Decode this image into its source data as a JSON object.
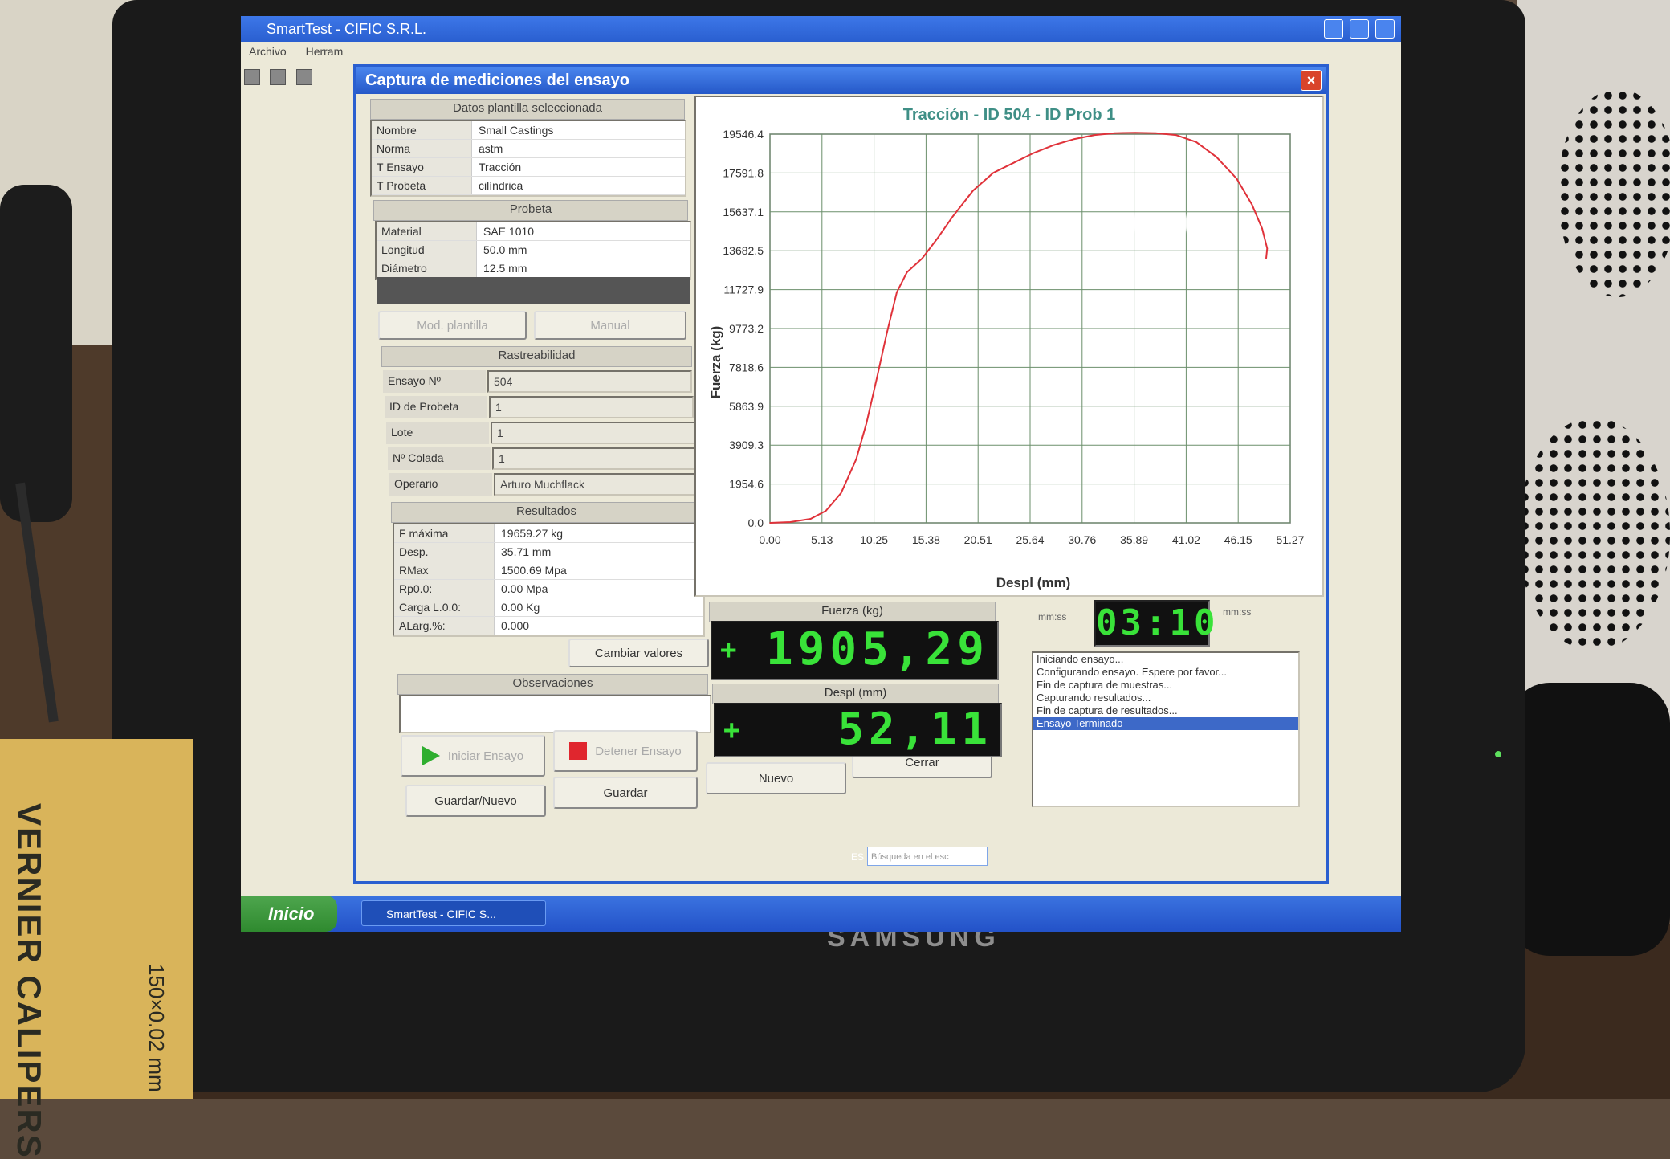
{
  "app": {
    "title": "SmartTest - CIFIC S.R.L.",
    "menu": [
      "Archivo",
      "Herram"
    ]
  },
  "dialog": {
    "title": "Captura de mediciones del ensayo",
    "close_label": "×",
    "template": {
      "header": "Datos plantilla seleccionada",
      "rows": [
        {
          "k": "Nombre",
          "v": "Small Castings"
        },
        {
          "k": "Norma",
          "v": "astm"
        },
        {
          "k": "T Ensayo",
          "v": "Tracción"
        },
        {
          "k": "T Probeta",
          "v": "cilíndrica"
        }
      ]
    },
    "probeta": {
      "header": "Probeta",
      "rows": [
        {
          "k": "Material",
          "v": "SAE 1010"
        },
        {
          "k": "Longitud",
          "v": "50.0 mm"
        },
        {
          "k": "Diámetro",
          "v": "12.5 mm"
        }
      ],
      "btn_mod": "Mod. plantilla",
      "btn_manual": "Manual"
    },
    "rastreabilidad": {
      "header": "Rastreabilidad",
      "ensayo_label": "Ensayo Nº",
      "ensayo_value": "504",
      "probeta_label": "ID de Probeta",
      "probeta_value": "1",
      "lote_label": "Lote",
      "lote_value": "1",
      "colada_label": "Nº Colada",
      "colada_value": "1",
      "operario_label": "Operario",
      "operario_value": "Arturo Muchflack"
    },
    "resultados": {
      "header": "Resultados",
      "rows": [
        {
          "k": "F máxima",
          "v": "19659.27 kg"
        },
        {
          "k": "Desp.",
          "v": "35.71 mm"
        },
        {
          "k": "RMax",
          "v": "1500.69 Mpa"
        },
        {
          "k": "Rp0.0:",
          "v": "0.00 Mpa"
        },
        {
          "k": "Carga L.0.0:",
          "v": "0.00 Kg"
        },
        {
          "k": "ALarg.%:",
          "v": "0.000"
        }
      ],
      "btn_cambiar": "Cambiar valores"
    },
    "observaciones": {
      "header": "Observaciones"
    },
    "buttons": {
      "iniciar": "Iniciar Ensayo",
      "detener": "Detener Ensayo",
      "guardar_nuevo": "Guardar/Nuevo",
      "guardar": "Guardar",
      "nuevo": "Nuevo",
      "cerrar": "Cerrar"
    },
    "displays": {
      "fuerza_label": "Fuerza (kg)",
      "fuerza_sign": "+",
      "fuerza_value": "1905,29",
      "despl_label": "Despl (mm)",
      "despl_sign": "+",
      "despl_value": "52,11",
      "timer_value": "03:10",
      "timer_left_label": "mm:ss",
      "timer_right_label": "mm:ss"
    },
    "log": [
      "Iniciando ensayo...",
      "Configurando ensayo. Espere por favor...",
      "Fin de captura de muestras...",
      "Capturando resultados...",
      "Fin de captura de resultados...",
      "Ensayo Terminado"
    ],
    "log_selected_index": 5
  },
  "chart_data": {
    "type": "line",
    "title": "Tracción - ID 504 - ID Prob 1",
    "xlabel": "Despl (mm)",
    "ylabel": "Fuerza (kg)",
    "xlim": [
      0,
      51.27
    ],
    "ylim": [
      0,
      19546.4
    ],
    "x_ticks": [
      "0.00",
      "5.13",
      "10.25",
      "15.38",
      "20.51",
      "25.64",
      "30.76",
      "35.89",
      "41.02",
      "46.15",
      "51.27"
    ],
    "y_ticks": [
      "0.0",
      "1954.6",
      "3909.3",
      "5863.9",
      "7818.6",
      "9773.2",
      "11727.9",
      "13682.5",
      "15637.1",
      "17591.8",
      "19546.4"
    ],
    "grid": true,
    "line_color": "#e0323a",
    "series": [
      {
        "values": [
          [
            0,
            0
          ],
          [
            2,
            40
          ],
          [
            4,
            200
          ],
          [
            5.5,
            600
          ],
          [
            7,
            1500
          ],
          [
            8.5,
            3200
          ],
          [
            9.5,
            5000
          ],
          [
            10.5,
            7200
          ],
          [
            11.5,
            9500
          ],
          [
            12.5,
            11600
          ],
          [
            13.5,
            12600
          ],
          [
            15,
            13300
          ],
          [
            16.5,
            14300
          ],
          [
            18,
            15400
          ],
          [
            20,
            16700
          ],
          [
            22,
            17600
          ],
          [
            24,
            18100
          ],
          [
            26,
            18600
          ],
          [
            28,
            19000
          ],
          [
            30,
            19300
          ],
          [
            32,
            19500
          ],
          [
            34,
            19600
          ],
          [
            36,
            19620
          ],
          [
            38,
            19600
          ],
          [
            40,
            19500
          ],
          [
            42,
            19150
          ],
          [
            44,
            18400
          ],
          [
            46,
            17300
          ],
          [
            47.5,
            16000
          ],
          [
            48.5,
            14800
          ],
          [
            49,
            13800
          ],
          [
            48.9,
            13300
          ]
        ]
      }
    ]
  },
  "taskbar": {
    "start_label": "Inicio",
    "task_label": "SmartTest - CIFIC S...",
    "lang": "ES",
    "search_placeholder": "Búsqueda en el esc"
  },
  "environment": {
    "monitor_brand": "SAMSUNG",
    "box_text": "VERNIER CALIPERS",
    "box_sub": "150×0.02 mm"
  }
}
